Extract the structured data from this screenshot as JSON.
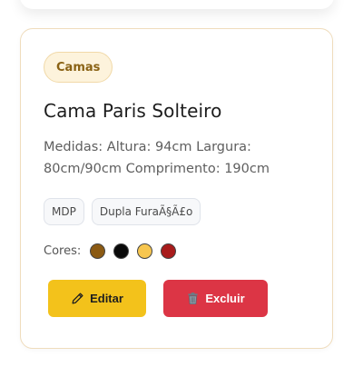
{
  "product": {
    "category": "Camas",
    "title": "Cama Paris Solteiro",
    "description": "Medidas: Altura: 94cm Largura: 80cm/90cm Comprimento: 190cm",
    "tags": [
      "MDP",
      "Dupla FuraÃ§Ã£o"
    ],
    "colors_label": "Cores:",
    "colors": [
      "#8b5a13",
      "#0a0a0a",
      "#f7c64f",
      "#a81b1b"
    ]
  },
  "actions": {
    "edit_label": "Editar",
    "edit_icon": "pencil-icon",
    "delete_label": "Excluir",
    "delete_icon": "trash-icon"
  },
  "theme": {
    "edit_color": "#f3c21b",
    "delete_color": "#dc3545",
    "category_bg": "#fdf3dc",
    "category_text": "#8a6214"
  }
}
